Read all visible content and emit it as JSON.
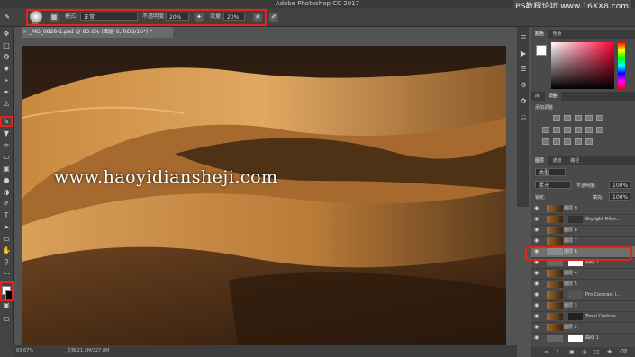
{
  "app": {
    "title": "Adobe Photoshop CC 2017"
  },
  "watermark_top": "PS教程论坛 www.16XX8.com",
  "options_bar": {
    "brush_size": "500",
    "mode_label": "模式:",
    "mode_value": "正常",
    "opacity_label": "不透明度:",
    "opacity_value": "20%",
    "flow_label": "流量:",
    "flow_value": "20%"
  },
  "document_tab": {
    "label": "_MG_0828-1.psd @ 83.6% (图层 6, RGB/16*) *",
    "close": "×"
  },
  "status": {
    "zoom": "83.67%",
    "doc": "文档:21.3M/327.8M"
  },
  "watermark": "www.haoyidiansheji.com",
  "color_panel": {
    "tabs": [
      "颜色",
      "色板"
    ]
  },
  "adjustments_panel": {
    "tabs": [
      "库",
      "调整"
    ],
    "subtitle": "添加调整"
  },
  "layers_panel": {
    "tabs": [
      "图层",
      "通道",
      "路径"
    ],
    "kind_filter": "类型",
    "blend_mode": "柔光",
    "opacity_label": "不透明度:",
    "opacity_value": "100%",
    "lock_label": "锁定:",
    "fill_label": "填充:",
    "fill_value": "100%",
    "layers": [
      {
        "name": "图层 9",
        "mask": false,
        "selected": false
      },
      {
        "name": "Skylight Filter...",
        "mask": true,
        "selected": false
      },
      {
        "name": "图层 8",
        "mask": false,
        "selected": false
      },
      {
        "name": "图层 7",
        "mask": false,
        "selected": false
      },
      {
        "name": "图层 6",
        "mask": false,
        "selected": true
      },
      {
        "name": "曲线 2",
        "mask": true,
        "selected": false
      },
      {
        "name": "图层 4",
        "mask": false,
        "selected": false
      },
      {
        "name": "图层 5",
        "mask": false,
        "selected": false
      },
      {
        "name": "Pro Contrast I...",
        "mask": true,
        "selected": false
      },
      {
        "name": "图层 3",
        "mask": false,
        "selected": false
      },
      {
        "name": "Tonal Contras...",
        "mask": true,
        "selected": false
      },
      {
        "name": "图层 2",
        "mask": false,
        "selected": false
      },
      {
        "name": "曲线 1",
        "mask": true,
        "selected": false
      }
    ]
  },
  "colors": {
    "highlight": "#e2241c",
    "dune_light": "#d9a05a",
    "dune_dark": "#3a2410"
  }
}
